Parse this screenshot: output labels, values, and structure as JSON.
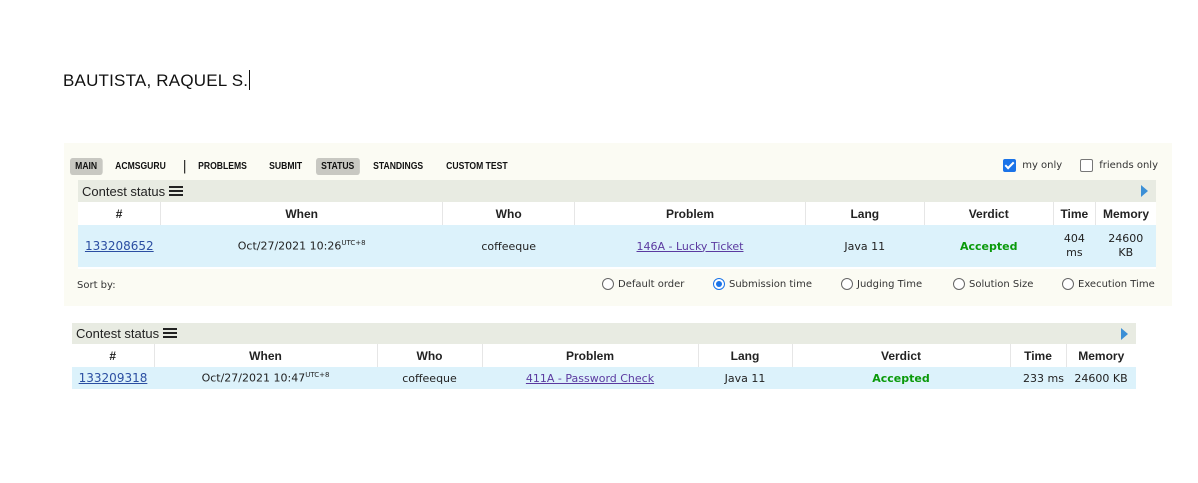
{
  "doc_name": "BAUTISTA, RAQUEL S.",
  "nav": {
    "items": [
      {
        "label": "MAIN",
        "active": true
      },
      {
        "label": "ACMSGURU",
        "active": false
      },
      {
        "label": "PROBLEMS",
        "active": false
      },
      {
        "label": "SUBMIT",
        "active": false
      },
      {
        "label": "STATUS",
        "active": true
      },
      {
        "label": "STANDINGS",
        "active": false
      },
      {
        "label": "CUSTOM TEST",
        "active": false
      }
    ],
    "separator": "|"
  },
  "filters": {
    "my_only": "my only",
    "my_only_checked": true,
    "friends_only": "friends only",
    "friends_only_checked": false
  },
  "status1": {
    "title": "Contest status",
    "columns": [
      "#",
      "When",
      "Who",
      "Problem",
      "Lang",
      "Verdict",
      "Time",
      "Memory"
    ],
    "row": {
      "id": "133208652",
      "when": "Oct/27/2021 10:26",
      "tz": "UTC+8",
      "who": "coffeeque",
      "problem": "146A - Lucky Ticket",
      "lang": "Java 11",
      "verdict": "Accepted",
      "time_val": "404",
      "time_unit": "ms",
      "mem_val": "24600",
      "mem_unit": "KB"
    }
  },
  "sort": {
    "label": "Sort by:",
    "options": [
      "Default order",
      "Submission time",
      "Judging Time",
      "Solution Size",
      "Execution Time"
    ],
    "selected": "Submission time"
  },
  "status2": {
    "title": "Contest status",
    "columns": [
      "#",
      "When",
      "Who",
      "Problem",
      "Lang",
      "Verdict",
      "Time",
      "Memory"
    ],
    "row": {
      "id": "133209318",
      "when": "Oct/27/2021 10:47",
      "tz": "UTC+8",
      "who": "coffeeque",
      "problem": "411A - Password Check",
      "lang": "Java 11",
      "verdict": "Accepted",
      "time": "233 ms",
      "memory": "24600 KB"
    }
  },
  "colors": {
    "accent": "#1a73e8",
    "accepted": "#0a9a0a",
    "row_bg": "#dcf2fb",
    "link": "#2b4ea2"
  }
}
